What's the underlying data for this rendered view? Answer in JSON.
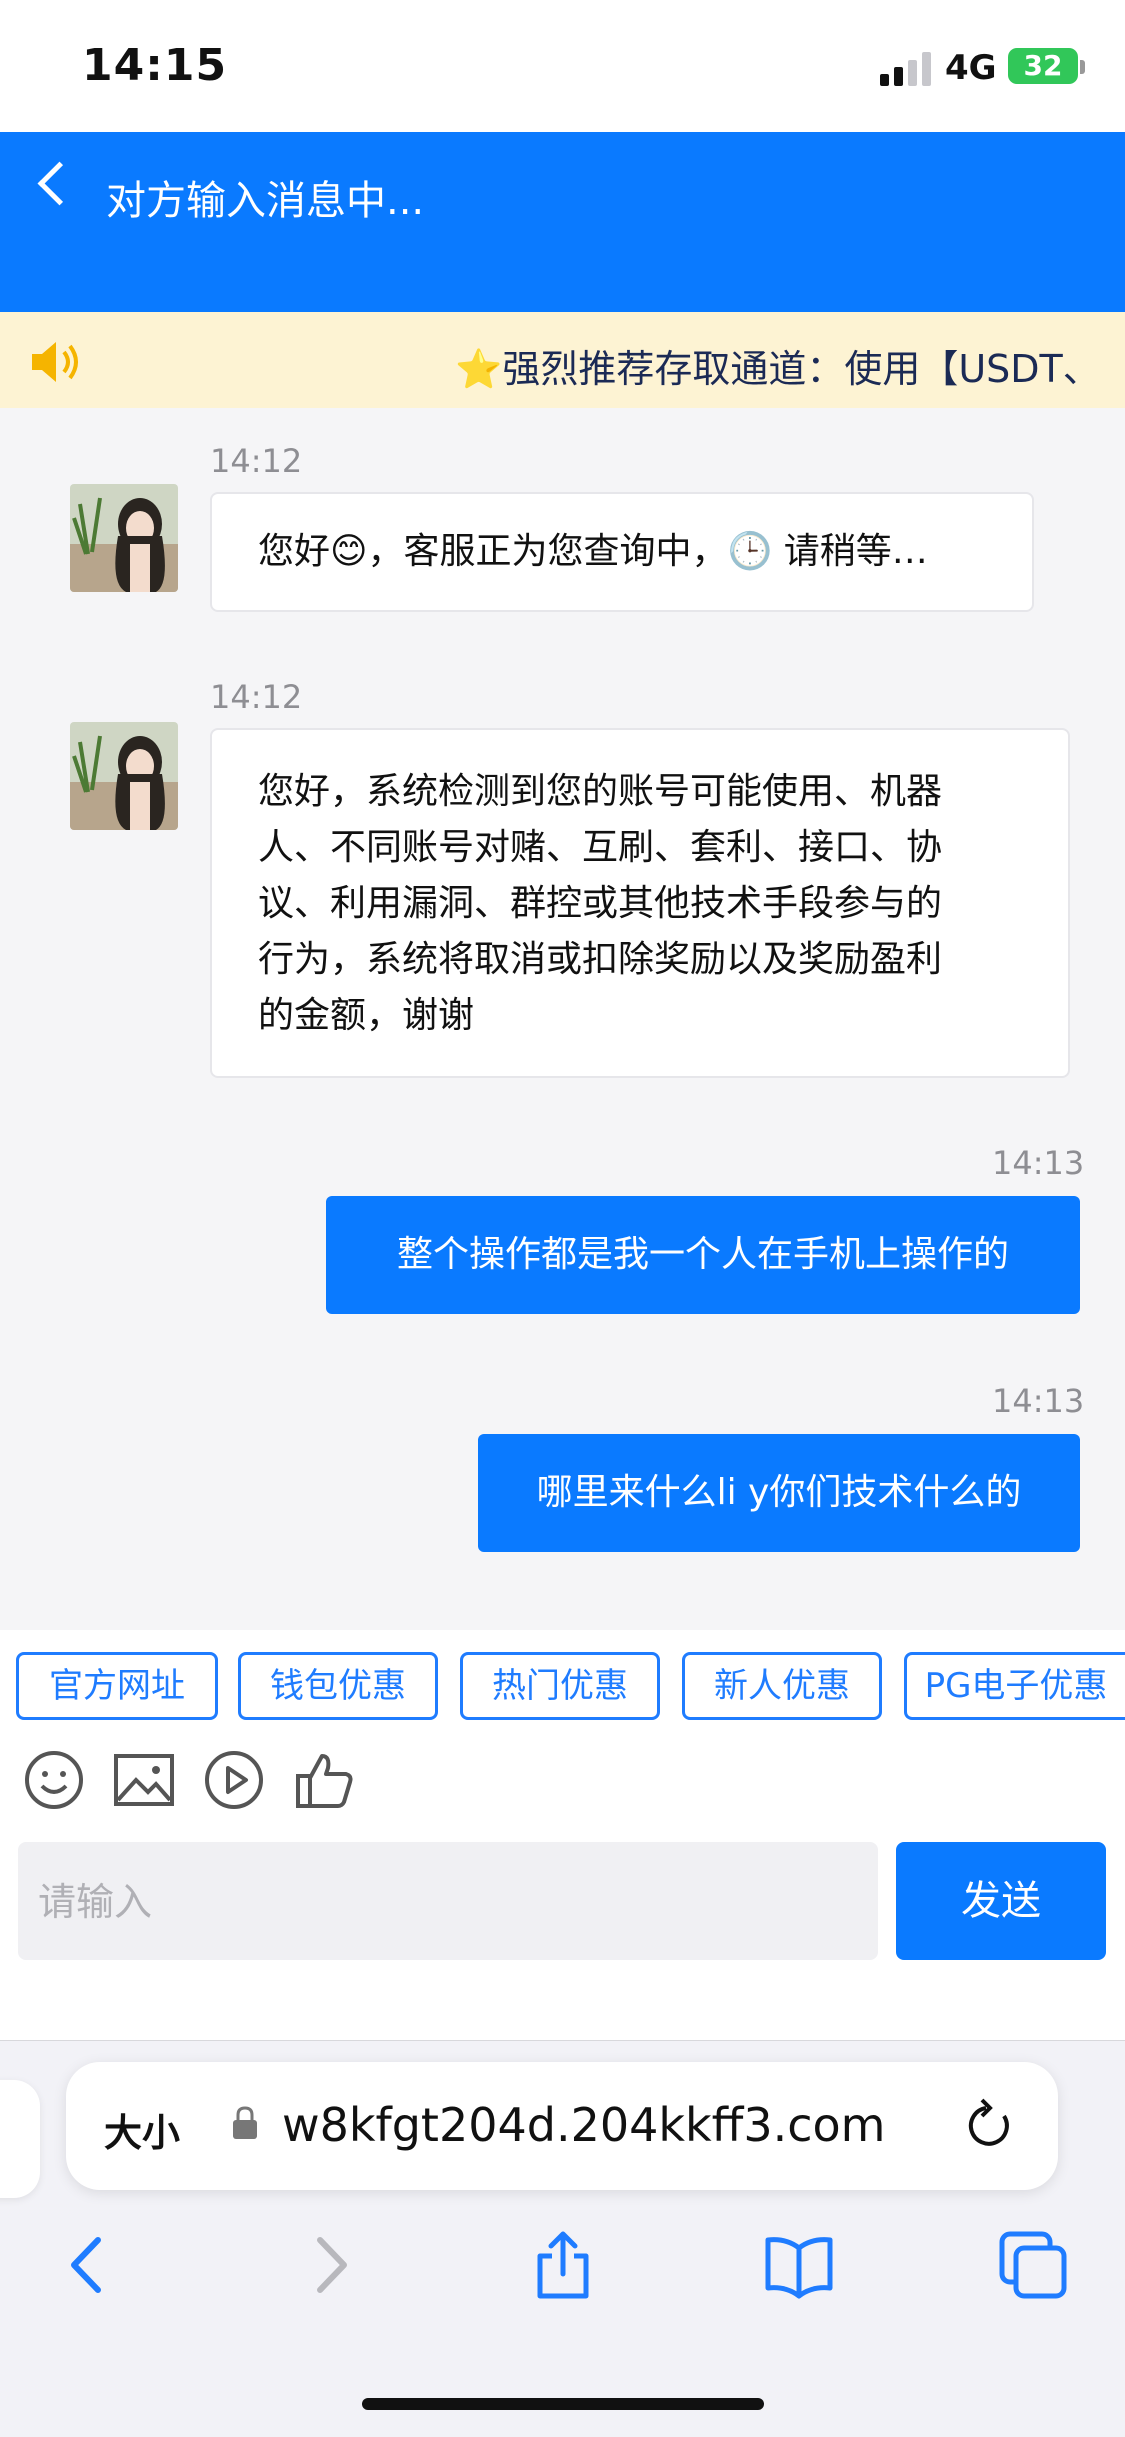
{
  "status_bar": {
    "time": "14:15",
    "network": "4G",
    "battery": "32"
  },
  "header": {
    "title": "对方输入消息中..."
  },
  "notice": {
    "text": "⭐强烈推荐存取通道：使用【USDT、"
  },
  "messages": [
    {
      "side": "in",
      "time": "14:12",
      "text": "您好😊，客服正为您查询中，🕒 请稍等…"
    },
    {
      "side": "in",
      "time": "14:12",
      "lines": [
        "您好，系统检测到您的账号可能使用、机器",
        "人、不同账号对赌、互刷、套利、接口、协",
        "议、利用漏洞、群控或其他技术手段参与的",
        "行为，系统将取消或扣除奖励以及奖励盈利",
        "的金额，谢谢"
      ]
    },
    {
      "side": "out",
      "time": "14:13",
      "text": "整个操作都是我一个人在手机上操作的"
    },
    {
      "side": "out",
      "time": "14:13",
      "text": "哪里来什么li y你们技术什么的"
    }
  ],
  "quick_links": [
    "官方网址",
    "钱包优惠",
    "热门优惠",
    "新人优惠",
    "PG电子优惠"
  ],
  "tools": [
    "emoji-icon",
    "image-icon",
    "video-icon",
    "thumbs-up-icon"
  ],
  "input": {
    "placeholder": "请输入",
    "value": ""
  },
  "send_label": "发送",
  "browser": {
    "text_size_label": "大小",
    "url": "w8kfgt204d.204kkff3.com"
  },
  "colors": {
    "primary": "#0a7aff",
    "notice_bg": "#fdf3d3",
    "battery_green": "#31c759"
  }
}
